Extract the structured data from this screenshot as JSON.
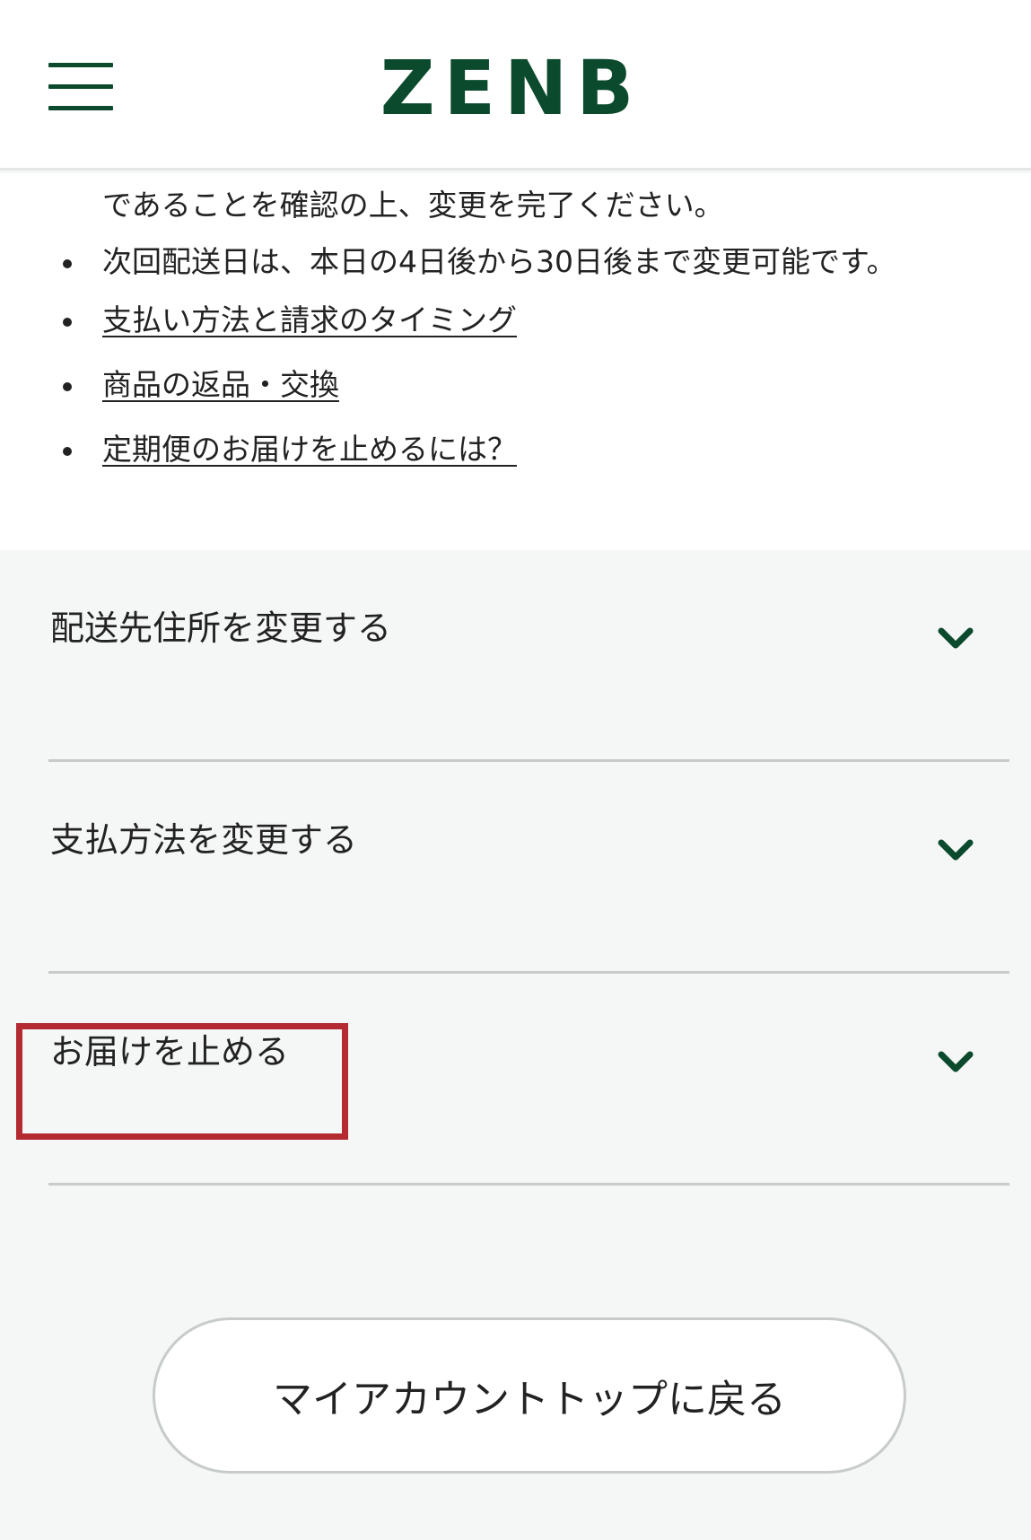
{
  "header": {
    "logo_text": "ZENB",
    "brand_color": "#0b4a2c"
  },
  "info": {
    "continued_text": "であることを確認の上、変更を完了ください。",
    "bullets": [
      {
        "text": "次回配送日は、本日の4日後から30日後まで変更可能です。",
        "is_link": false
      },
      {
        "text": "支払い方法と請求のタイミング",
        "is_link": true
      },
      {
        "text": "商品の返品・交換",
        "is_link": true
      },
      {
        "text": "定期便のお届けを止めるには？",
        "is_link": true
      }
    ]
  },
  "accordion": {
    "items": [
      {
        "label": "配送先住所を変更する",
        "icon": "chevron-down-icon"
      },
      {
        "label": "支払方法を変更する",
        "icon": "chevron-down-icon"
      },
      {
        "label": "お届けを止める",
        "icon": "chevron-down-icon"
      }
    ]
  },
  "highlight_color": "#b42a31",
  "back_button": {
    "label": "マイアカウントトップに戻る"
  }
}
